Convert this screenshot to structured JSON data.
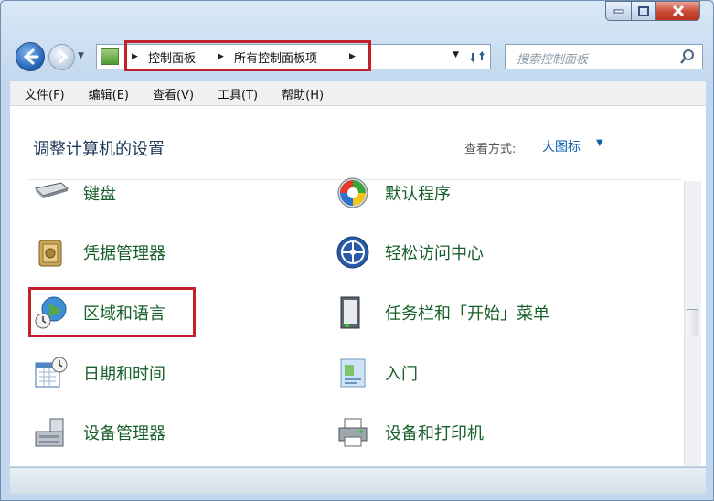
{
  "window": {
    "caption_buttons": [
      "minimize",
      "maximize",
      "close"
    ]
  },
  "address": {
    "crumbs": [
      "控制面板",
      "所有控制面板项"
    ]
  },
  "search": {
    "placeholder": "搜索控制面板"
  },
  "menu": [
    "文件(F)",
    "编辑(E)",
    "查看(V)",
    "工具(T)",
    "帮助(H)"
  ],
  "content": {
    "title": "调整计算机的设置",
    "view_label": "查看方式:",
    "view_value": "大图标"
  },
  "items": {
    "keyboard": "键盘",
    "default_programs": "默认程序",
    "credential_manager": "凭据管理器",
    "ease_of_access": "轻松访问中心",
    "region_language": "区域和语言",
    "taskbar_start": "任务栏和「开始」菜单",
    "date_time": "日期和时间",
    "getting_started": "入门",
    "device_manager": "设备管理器",
    "devices_printers": "设备和打印机"
  },
  "colors": {
    "highlight_box": "#c2202b",
    "link_green": "#175f2a",
    "accent_blue": "#0b61b0"
  }
}
